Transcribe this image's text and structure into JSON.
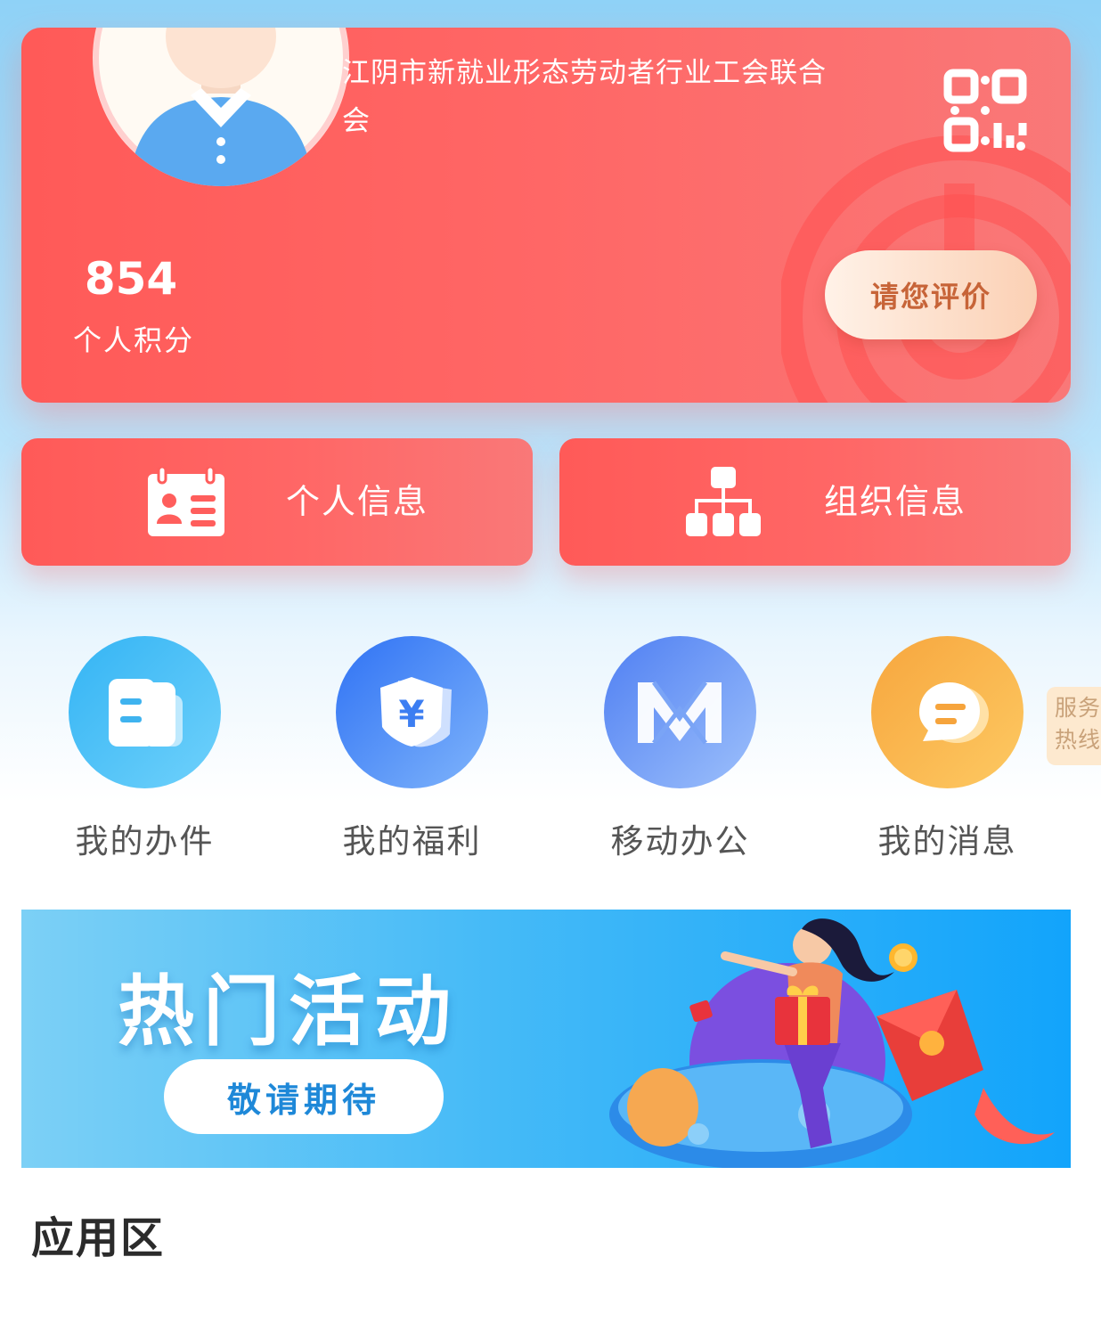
{
  "profile": {
    "org_name": "江阴市新就业形态劳动者行业工会联合会",
    "points_value": "854",
    "points_label": "个人积分",
    "rate_button": "请您评价"
  },
  "info_buttons": [
    {
      "label": "个人信息",
      "icon": "id-card-icon"
    },
    {
      "label": "组织信息",
      "icon": "org-chart-icon"
    }
  ],
  "quick_menu": [
    {
      "label": "我的办件",
      "icon": "document-icon"
    },
    {
      "label": "我的福利",
      "icon": "yuan-shield-icon"
    },
    {
      "label": "移动办公",
      "icon": "m-logo-icon"
    },
    {
      "label": "我的消息",
      "icon": "chat-bubble-icon"
    }
  ],
  "hotline": {
    "line1": "服务",
    "line2": "热线"
  },
  "banner": {
    "title": "热门活动",
    "button": "敬请期待"
  },
  "section": {
    "title": "应用区"
  },
  "colors": {
    "card_red": "#ff5a58",
    "rate_text": "#c76438",
    "banner_blue": "#12a4fb",
    "hotline_bg": "#fde9cf"
  }
}
